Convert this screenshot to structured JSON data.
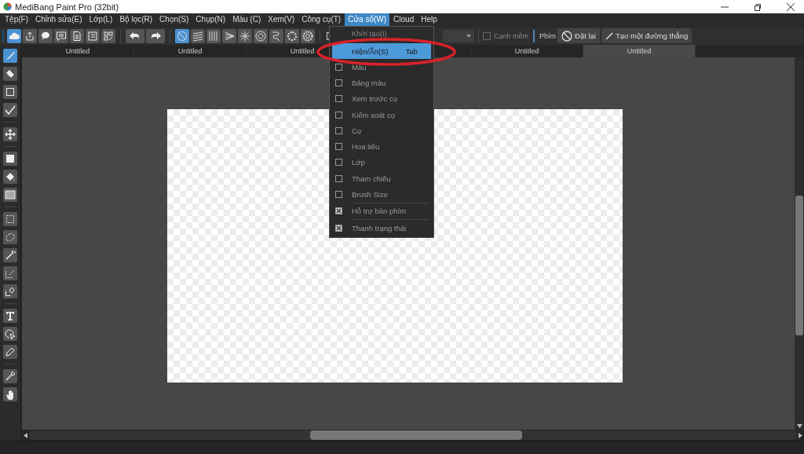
{
  "window": {
    "title": "MediBang Paint Pro (32bit)"
  },
  "menu_bar": [
    {
      "label": "Tệp(F)",
      "selected": false
    },
    {
      "label": "Chỉnh sửa(E)",
      "selected": false
    },
    {
      "label": "Lớp(L)",
      "selected": false
    },
    {
      "label": "Bộ lọc(R)",
      "selected": false
    },
    {
      "label": "Chọn(S)",
      "selected": false
    },
    {
      "label": "Chụp(N)",
      "selected": false
    },
    {
      "label": "Màu (C)",
      "selected": false
    },
    {
      "label": "Xem(V)",
      "selected": false
    },
    {
      "label": "Công cụ(T)",
      "selected": false
    },
    {
      "label": "Cửa sổ(W)",
      "selected": true
    },
    {
      "label": "Cloud",
      "selected": false
    },
    {
      "label": "Help",
      "selected": false
    }
  ],
  "toolbar": {
    "file_tools": [
      {
        "selected": true
      },
      {
        "selected": false
      },
      {
        "selected": false
      },
      {
        "selected": false
      },
      {
        "selected": false
      },
      {
        "selected": false
      },
      {
        "selected": false
      }
    ],
    "snap_tools": [
      {
        "selected": true
      },
      {
        "selected": false
      },
      {
        "selected": false
      },
      {
        "selected": false
      },
      {
        "selected": false
      },
      {
        "selected": false
      },
      {
        "selected": false
      },
      {
        "selected": false
      }
    ],
    "soft_edge": {
      "label": "Cạnh mềm",
      "checked": false
    },
    "keys_label": "Phím",
    "reset_button": "Đặt lại",
    "line_button": "Tạo một đường thẳng"
  },
  "tabs": [
    {
      "label": "Untitled",
      "selected": false
    },
    {
      "label": "Untitled",
      "selected": false
    },
    {
      "label": "Untitled",
      "selected": false
    },
    {
      "label": "Untitled",
      "selected": false
    },
    {
      "label": "Untitled",
      "selected": true
    }
  ],
  "tools": [
    {
      "selected": true
    },
    {
      "selected": false
    },
    {
      "selected": false
    },
    {
      "selected": false
    },
    {
      "selected": false
    },
    {
      "selected": false
    },
    {
      "selected": false
    },
    {
      "selected": false
    },
    {
      "selected": false
    },
    {
      "selected": false
    },
    {
      "selected": false
    },
    {
      "selected": false
    },
    {
      "selected": false
    },
    {
      "selected": false
    },
    {
      "selected": false
    },
    {
      "selected": false
    },
    {
      "selected": false
    },
    {
      "selected": false
    }
  ],
  "window_menu": {
    "items": [
      {
        "kind": "command",
        "label": "Khởi tạo(I)",
        "selected": false
      },
      {
        "kind": "command",
        "label": "Hiện/Ẩn(S)",
        "shortcut": "Tab",
        "selected": true
      },
      {
        "kind": "check",
        "label": "Màu",
        "checked": false
      },
      {
        "kind": "check",
        "label": "Bảng màu",
        "checked": false
      },
      {
        "kind": "check",
        "label": "Xem trước cọ",
        "checked": false
      },
      {
        "kind": "check",
        "label": "Kiểm soát cọ",
        "checked": false
      },
      {
        "kind": "check",
        "label": "Cọ",
        "checked": false
      },
      {
        "kind": "check",
        "label": "Hoa tiêu",
        "checked": false
      },
      {
        "kind": "check",
        "label": "Lớp",
        "checked": false
      },
      {
        "kind": "check",
        "label": "Tham chiếu",
        "checked": false
      },
      {
        "kind": "check",
        "label": "Brush Size",
        "checked": false
      },
      {
        "kind": "separator"
      },
      {
        "kind": "check",
        "label": "Hỗ trợ bàn phím",
        "checked": true
      },
      {
        "kind": "separator"
      },
      {
        "kind": "check",
        "label": "Thanh trạng thái",
        "checked": true
      }
    ]
  }
}
